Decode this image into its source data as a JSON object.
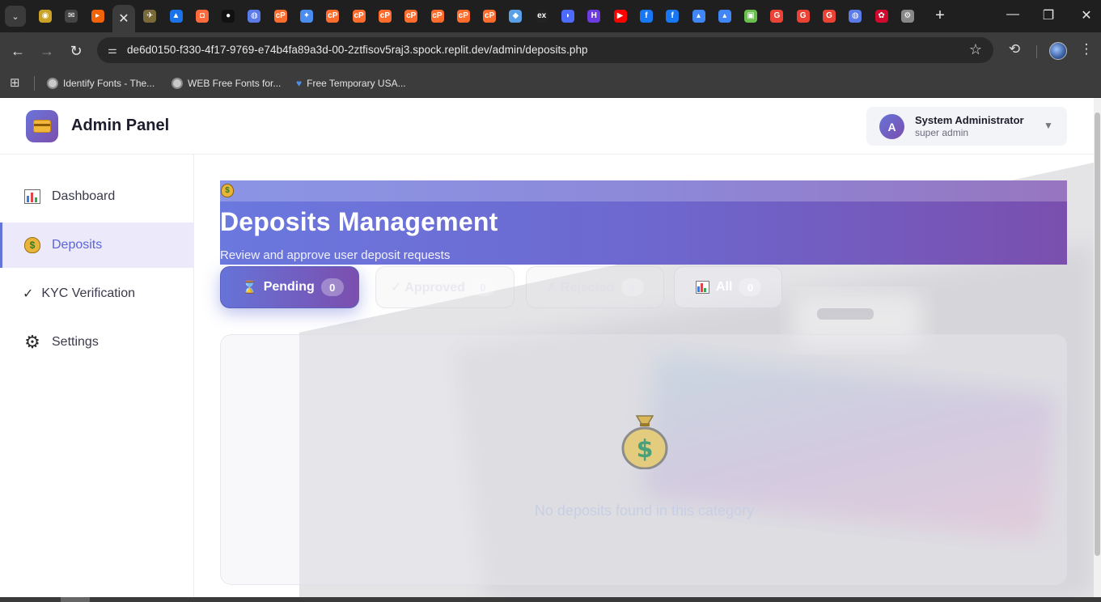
{
  "browser": {
    "url": "de6d0150-f330-4f17-9769-e74b4fa89a3d-00-2ztfisov5raj3.spock.replit.dev/admin/deposits.php",
    "tabs": [
      {
        "icon": "shield-icon",
        "color": "#c9a227",
        "glyph": "◉"
      },
      {
        "icon": "mail-icon",
        "color": "#444",
        "glyph": "✉"
      },
      {
        "icon": "replit-icon",
        "color": "#f26207",
        "glyph": "▸"
      },
      {
        "icon": "close-icon",
        "color": "#3c3c3c",
        "glyph": "✕",
        "active": true
      },
      {
        "icon": "plane-icon",
        "color": "#7a6a3a",
        "glyph": "✈"
      },
      {
        "icon": "vercel-icon",
        "color": "#1a73e8",
        "glyph": "▲"
      },
      {
        "icon": "orange-square-icon",
        "color": "#ff6a3d",
        "glyph": "◘"
      },
      {
        "icon": "github-icon",
        "color": "#111",
        "glyph": "●"
      },
      {
        "icon": "globe-icon",
        "color": "#5b7be8",
        "glyph": "◍"
      },
      {
        "icon": "cpanel-icon",
        "color": "#ff6c2c",
        "glyph": "cP"
      },
      {
        "icon": "gemini-icon",
        "color": "#4a8cf0",
        "glyph": "✦"
      },
      {
        "icon": "cpanel-icon",
        "color": "#ff6c2c",
        "glyph": "cP"
      },
      {
        "icon": "cpanel-icon",
        "color": "#ff6c2c",
        "glyph": "cP"
      },
      {
        "icon": "cpanel-icon",
        "color": "#ff6c2c",
        "glyph": "cP"
      },
      {
        "icon": "cpanel-icon",
        "color": "#ff6c2c",
        "glyph": "cP"
      },
      {
        "icon": "cpanel-icon",
        "color": "#ff6c2c",
        "glyph": "cP"
      },
      {
        "icon": "cpanel-icon",
        "color": "#ff6c2c",
        "glyph": "cP"
      },
      {
        "icon": "cpanel-icon",
        "color": "#ff6c2c",
        "glyph": "cP"
      },
      {
        "icon": "chat-icon",
        "color": "#5aa0e8",
        "glyph": "◆"
      },
      {
        "icon": "ex-icon",
        "color": "#222",
        "glyph": "ex"
      },
      {
        "icon": "deepseek-icon",
        "color": "#4d6bfe",
        "glyph": "◗"
      },
      {
        "icon": "h-icon",
        "color": "#6c3ce0",
        "glyph": "H"
      },
      {
        "icon": "youtube-icon",
        "color": "#ff0000",
        "glyph": "▶"
      },
      {
        "icon": "facebook-icon",
        "color": "#1877f2",
        "glyph": "f"
      },
      {
        "icon": "facebook-icon",
        "color": "#1877f2",
        "glyph": "f"
      },
      {
        "icon": "ads-icon",
        "color": "#4285f4",
        "glyph": "▴"
      },
      {
        "icon": "ads-icon",
        "color": "#4285f4",
        "glyph": "▴"
      },
      {
        "icon": "android-icon",
        "color": "#6bbf4e",
        "glyph": "▣"
      },
      {
        "icon": "google-icon",
        "color": "#ea4335",
        "glyph": "G"
      },
      {
        "icon": "google-icon",
        "color": "#ea4335",
        "glyph": "G"
      },
      {
        "icon": "google-icon",
        "color": "#ea4335",
        "glyph": "G"
      },
      {
        "icon": "globe-icon",
        "color": "#5b7be8",
        "glyph": "◍"
      },
      {
        "icon": "huawei-icon",
        "color": "#cf0a2c",
        "glyph": "✿"
      },
      {
        "icon": "settings-icon",
        "color": "#888",
        "glyph": "⚙"
      }
    ],
    "bookmarks": [
      {
        "label": "Identify Fonts - The..."
      },
      {
        "label": "WEB Free Fonts for..."
      },
      {
        "label": "Free Temporary USA..."
      }
    ]
  },
  "app": {
    "brand": "Admin Panel",
    "user": {
      "initial": "A",
      "name": "System Administrator",
      "role": "super admin"
    }
  },
  "sidebar": {
    "items": [
      {
        "label": "Dashboard",
        "icon": "bar-chart-icon",
        "active": false
      },
      {
        "label": "Deposits",
        "icon": "money-bag-icon",
        "active": true
      },
      {
        "label": "KYC Verification",
        "icon": "check-icon",
        "active": false
      },
      {
        "label": "Settings",
        "icon": "gear-icon",
        "active": false
      }
    ]
  },
  "page": {
    "title": "Deposits Management",
    "subtitle": "Review and approve user deposit requests",
    "filters": [
      {
        "label": "Pending",
        "count": "0",
        "icon": "hourglass-icon",
        "active": true
      },
      {
        "label": "✓ Approved",
        "count": "0",
        "icon": "check-icon",
        "active": false
      },
      {
        "label": "✗ Rejected",
        "count": "0",
        "icon": "cross-icon",
        "active": false
      },
      {
        "label": "All",
        "count": "0",
        "icon": "bar-chart-icon",
        "active": false
      }
    ],
    "empty_message": "No deposits found in this category"
  }
}
